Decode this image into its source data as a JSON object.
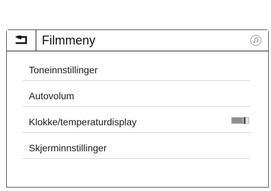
{
  "header": {
    "title": "Filmmeny",
    "back_icon": "back-arrow-icon",
    "music_icon": "music-note-icon"
  },
  "menu": {
    "items": [
      {
        "label": "Toneinnstillinger"
      },
      {
        "label": "Autovolum"
      },
      {
        "label": "Klokke/temperaturdisplay",
        "has_toggle": true,
        "toggle_on": true
      },
      {
        "label": "Skjerminnstillinger"
      }
    ]
  },
  "colors": {
    "border": "#2b2b2b",
    "divider": "#d9d9d9",
    "toggle_fill": "#8f8f8f"
  }
}
